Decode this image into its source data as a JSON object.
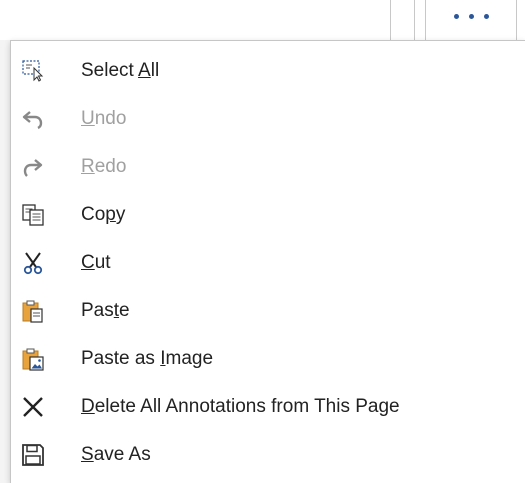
{
  "toolbar": {
    "more_button": {
      "icon": "more-horizontal-dots-icon",
      "accent": "#2b579a"
    }
  },
  "menu": {
    "items": [
      {
        "label": "Select All",
        "mnemonic_index": 7,
        "icon": "select-all-icon",
        "enabled": true
      },
      {
        "label": "Undo",
        "mnemonic_index": 0,
        "icon": "undo-icon",
        "enabled": false
      },
      {
        "label": "Redo",
        "mnemonic_index": 0,
        "icon": "redo-icon",
        "enabled": false
      },
      {
        "label": "Copy",
        "mnemonic_index": 2,
        "icon": "copy-icon",
        "enabled": true
      },
      {
        "label": "Cut",
        "mnemonic_index": 0,
        "icon": "cut-icon",
        "enabled": true
      },
      {
        "label": "Paste",
        "mnemonic_index": 3,
        "icon": "paste-icon",
        "enabled": true
      },
      {
        "label": "Paste as Image",
        "mnemonic_index": 9,
        "icon": "paste-as-image-icon",
        "enabled": true
      },
      {
        "label": "Delete All Annotations from This Page",
        "mnemonic_index": 0,
        "icon": "delete-x-icon",
        "enabled": true
      },
      {
        "label": "Save As",
        "mnemonic_index": 0,
        "icon": "save-icon",
        "enabled": true
      }
    ]
  },
  "colors": {
    "text": "#222222",
    "disabled_text": "#a0a0a0",
    "icon": "#333333",
    "paste_accent": "#e8a33d"
  }
}
